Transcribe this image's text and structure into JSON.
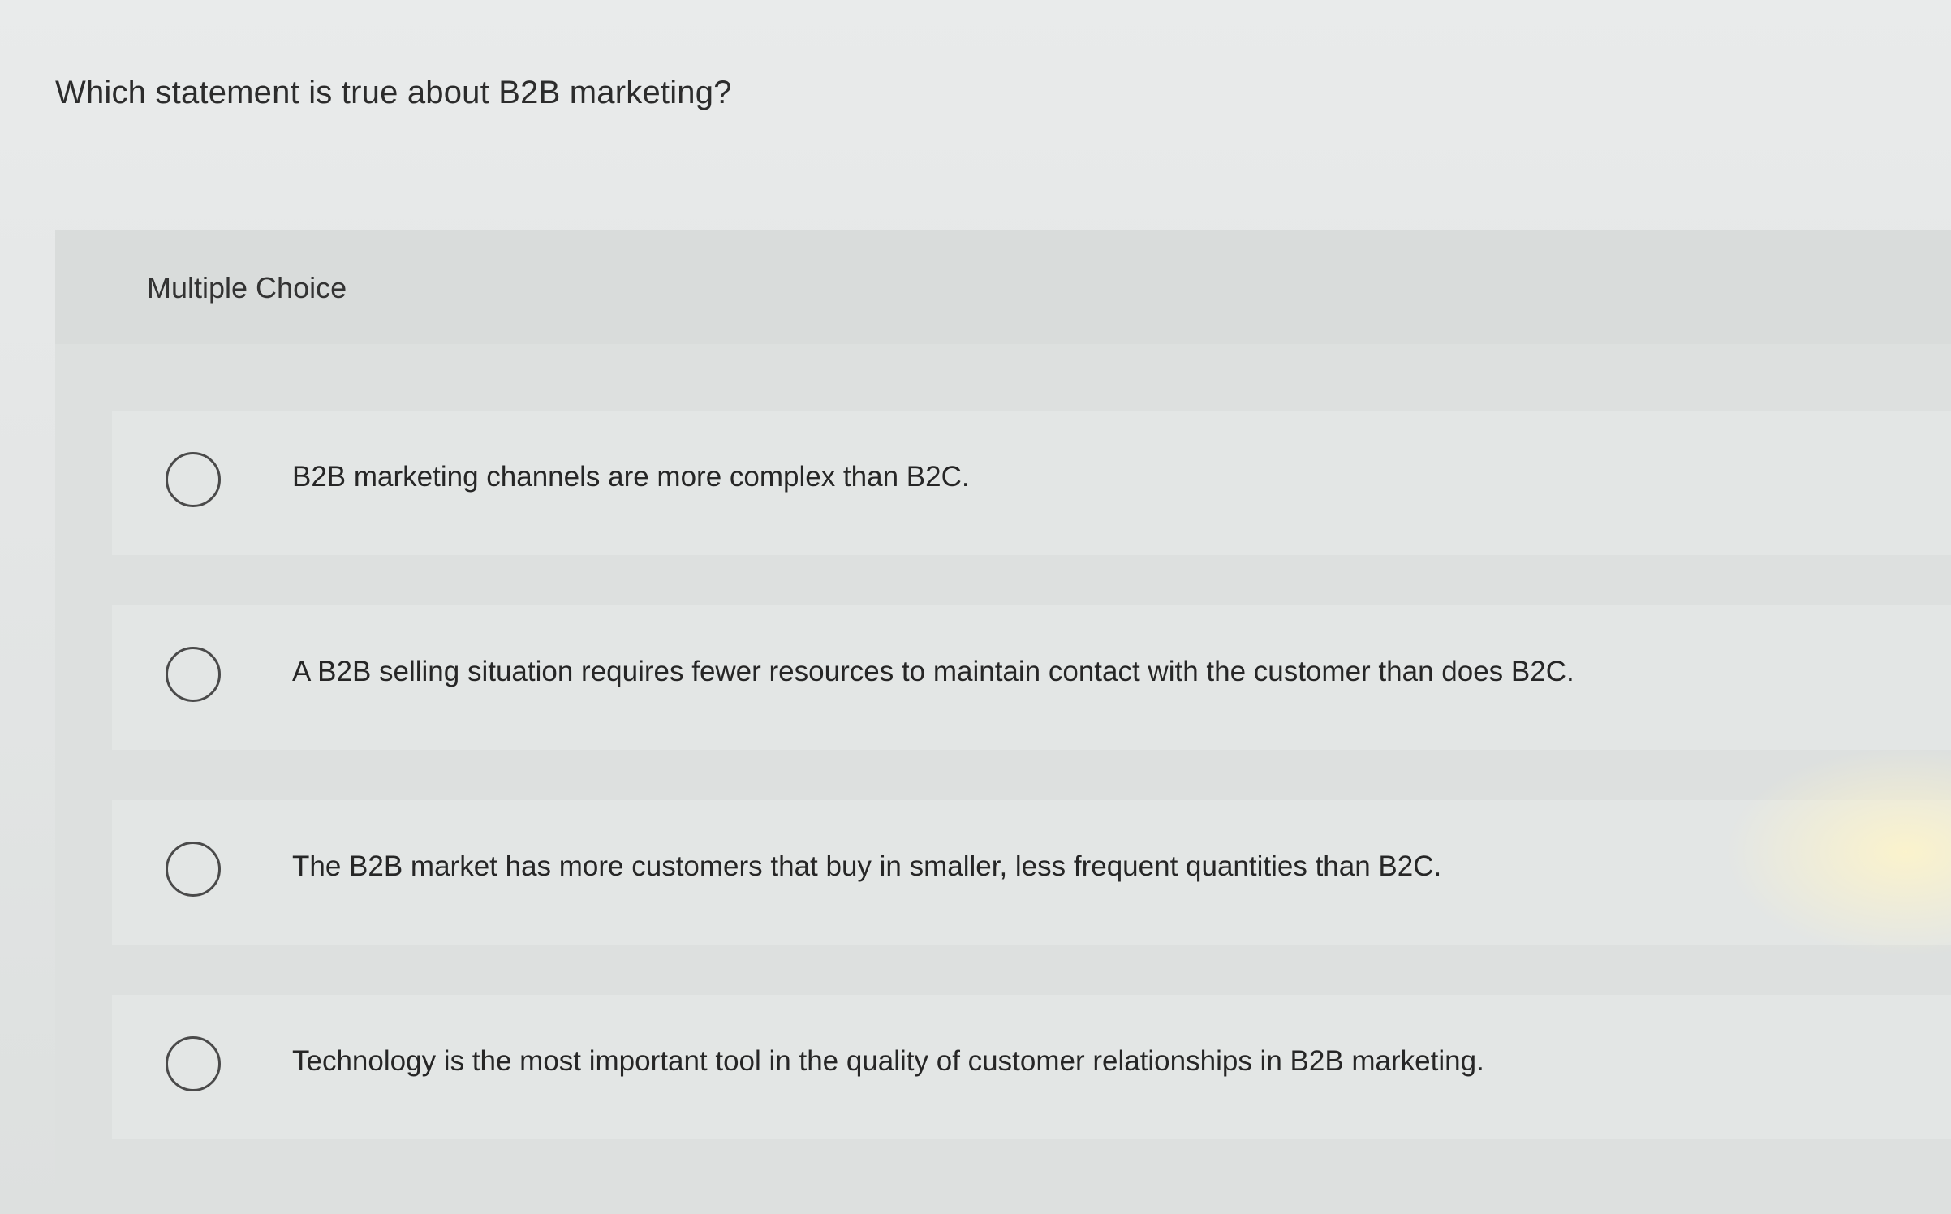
{
  "question": {
    "text": "Which statement is true about B2B marketing?"
  },
  "panel": {
    "label": "Multiple Choice"
  },
  "options": [
    {
      "text": "B2B marketing channels are more complex than B2C.",
      "selected": false
    },
    {
      "text": "A B2B selling situation requires fewer resources to maintain contact with the customer than does B2C.",
      "selected": false
    },
    {
      "text": "The B2B market has more customers that buy in smaller, less frequent quantities than B2C.",
      "selected": false
    },
    {
      "text": "Technology is the most important tool in the quality of customer relationships in B2B marketing.",
      "selected": false
    }
  ],
  "icons": {
    "radio": "radio-unchecked-icon"
  },
  "colors": {
    "background": "#e8eaea",
    "panel": "#dde0df",
    "option_row": "#e3e6e5",
    "text": "#2b2b2b",
    "radio_border": "#4a4a4a"
  }
}
